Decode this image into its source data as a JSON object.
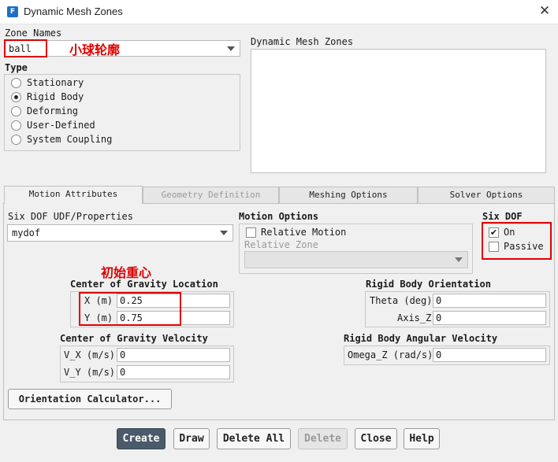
{
  "window": {
    "app_icon": "F",
    "title": "Dynamic Mesh Zones",
    "close": "✕"
  },
  "zone_names": {
    "label": "Zone Names",
    "value": "ball",
    "annotation": "小球轮廓"
  },
  "dynamic_zones": {
    "label": "Dynamic Mesh Zones"
  },
  "type": {
    "label": "Type",
    "options": [
      "Stationary",
      "Rigid Body",
      "Deforming",
      "User-Defined",
      "System Coupling"
    ],
    "selected": "Rigid Body"
  },
  "tabs": [
    {
      "label": "Motion Attributes",
      "active": true
    },
    {
      "label": "Geometry Definition",
      "active": false,
      "disabled": true
    },
    {
      "label": "Meshing Options",
      "active": false
    },
    {
      "label": "Solver Options",
      "active": false
    }
  ],
  "six_dof_udf": {
    "label": "Six DOF UDF/Properties",
    "value": "mydof"
  },
  "motion_options": {
    "label": "Motion Options",
    "relative_motion": {
      "label": "Relative Motion",
      "checked": false
    },
    "relative_zone": {
      "label": "Relative Zone",
      "value": ""
    }
  },
  "six_dof": {
    "label": "Six DOF",
    "on": {
      "label": "On",
      "checked": true
    },
    "passive": {
      "label": "Passive",
      "checked": false
    }
  },
  "annotation_cg": "初始重心",
  "cg_location": {
    "label": "Center of Gravity Location",
    "x": {
      "label": "X (m)",
      "value": "0.25"
    },
    "y": {
      "label": "Y (m)",
      "value": "0.75"
    }
  },
  "rb_orientation": {
    "label": "Rigid Body Orientation",
    "theta": {
      "label": "Theta (deg)",
      "value": "0"
    },
    "axis_z": {
      "label": "Axis_Z",
      "value": "0"
    }
  },
  "cg_velocity": {
    "label": "Center of Gravity Velocity",
    "vx": {
      "label": "V_X (m/s)",
      "value": "0"
    },
    "vy": {
      "label": "V_Y (m/s)",
      "value": "0"
    }
  },
  "rb_angular_velocity": {
    "label": "Rigid Body Angular Velocity",
    "omega_z": {
      "label": "Omega_Z (rad/s)",
      "value": "0"
    }
  },
  "orientation_calculator": "Orientation Calculator...",
  "buttons": {
    "create": "Create",
    "draw": "Draw",
    "delete_all": "Delete All",
    "delete": "Delete",
    "close": "Close",
    "help": "Help"
  },
  "colors": {
    "annotation_red": "#e00000",
    "primary_button": "#4a5a6a",
    "app_icon": "#1f6fc5"
  }
}
